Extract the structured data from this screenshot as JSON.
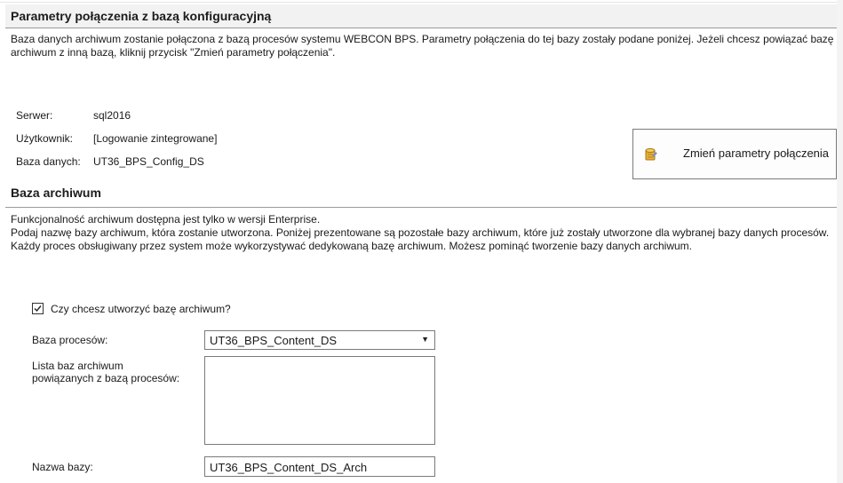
{
  "connection": {
    "title": "Parametry połączenia z bazą konfiguracyjną",
    "description": "Baza danych archiwum zostanie połączona z bazą procesów systemu WEBCON BPS. Parametry połączenia do tej bazy zostały podane poniżej. Jeżeli chcesz powiązać bazę archiwum z inną bazą, kliknij przycisk \"Zmień parametry połączenia\".",
    "server_label": "Serwer:",
    "server_value": "sql2016",
    "user_label": "Użytkownik:",
    "user_value": "[Logowanie zintegrowane]",
    "db_label": "Baza danych:",
    "db_value": "UT36_BPS_Config_DS",
    "change_button_label": "Zmień parametry połączenia",
    "change_button_icon": "database-edit-icon"
  },
  "archive": {
    "title": "Baza archiwum",
    "line1": "Funkcjonalność archiwum dostępna jest tylko w wersji Enterprise.",
    "line2": "Podaj nazwę bazy archiwum, która zostanie utworzona. Poniżej prezentowane są pozostałe bazy archiwum, które już zostały utworzone dla wybranej bazy danych procesów. Każdy proces obsługiwany przez system może wykorzystywać dedykowaną bazę archiwum. Możesz pominąć tworzenie bazy danych archiwum.",
    "checkbox_label": "Czy chcesz utworzyć bazę archiwum?",
    "checkbox_checked": true,
    "process_db_label": "Baza procesów:",
    "process_db_value": "UT36_BPS_Content_DS",
    "list_label_line1": "Lista baz archiwum",
    "list_label_line2": "powiązanych z bazą procesów:",
    "list_items": [],
    "name_label": "Nazwa bazy:",
    "name_value": "UT36_BPS_Content_DS_Arch"
  }
}
